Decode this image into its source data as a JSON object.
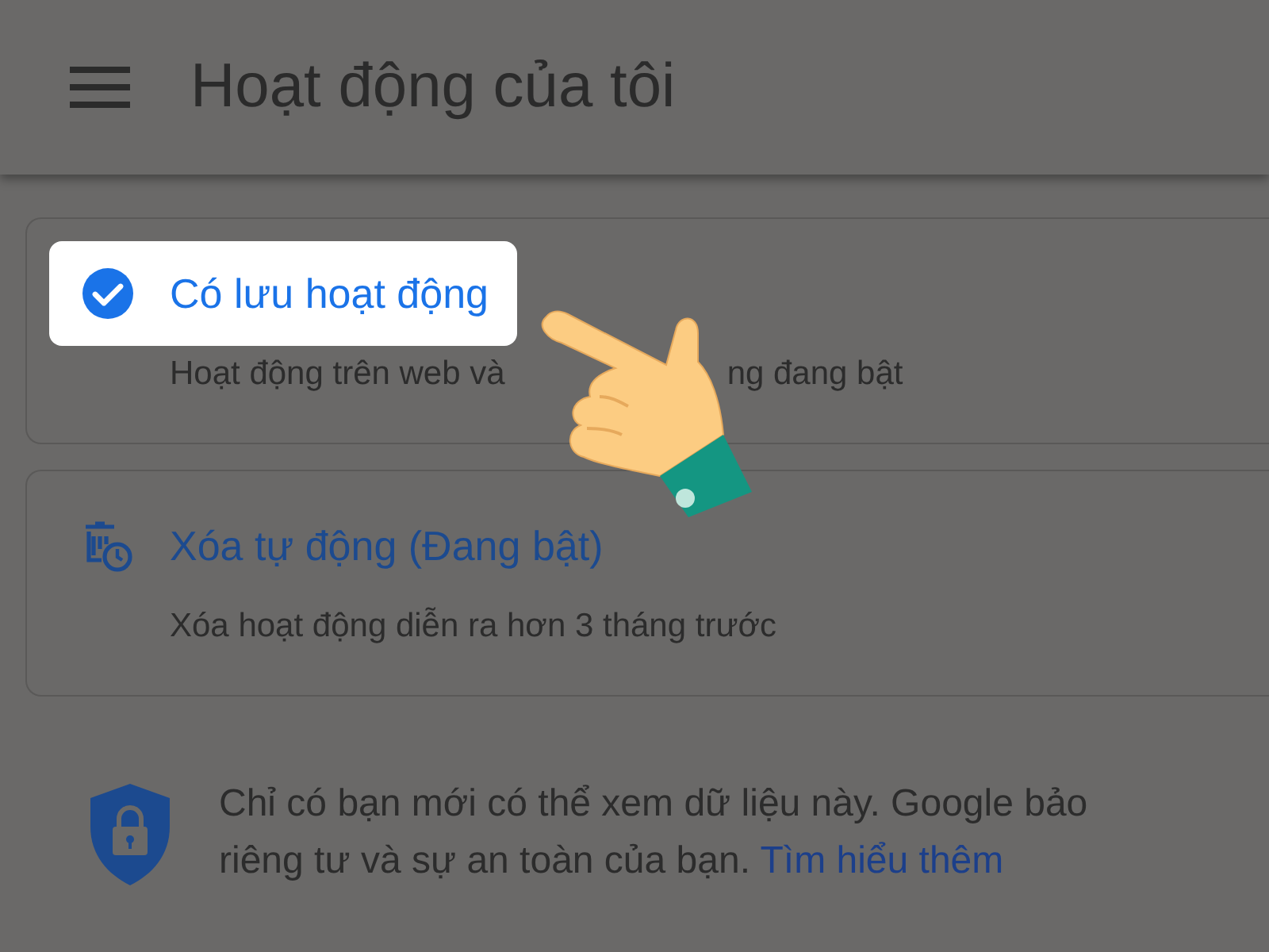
{
  "app_bar": {
    "title": "Hoạt động của tôi"
  },
  "cards": [
    {
      "kind": "check",
      "title": "Có lưu hoạt động",
      "highlighted": true,
      "subtitle_parts": [
        "Hoạt động trên web và",
        "ng đang bật"
      ]
    },
    {
      "kind": "auto_delete",
      "title": "Xóa tự động (Đang bật)",
      "highlighted": false,
      "subtitle_parts": [
        "Xóa hoạt động diễn ra hơn 3 tháng trước"
      ]
    }
  ],
  "privacy": {
    "line_1": "Chỉ có bạn mới có thể xem dữ liệu này. Google bảo",
    "line_2": "riêng tư và sự an toàn của bạn.",
    "link": "Tìm hiểu thêm"
  }
}
